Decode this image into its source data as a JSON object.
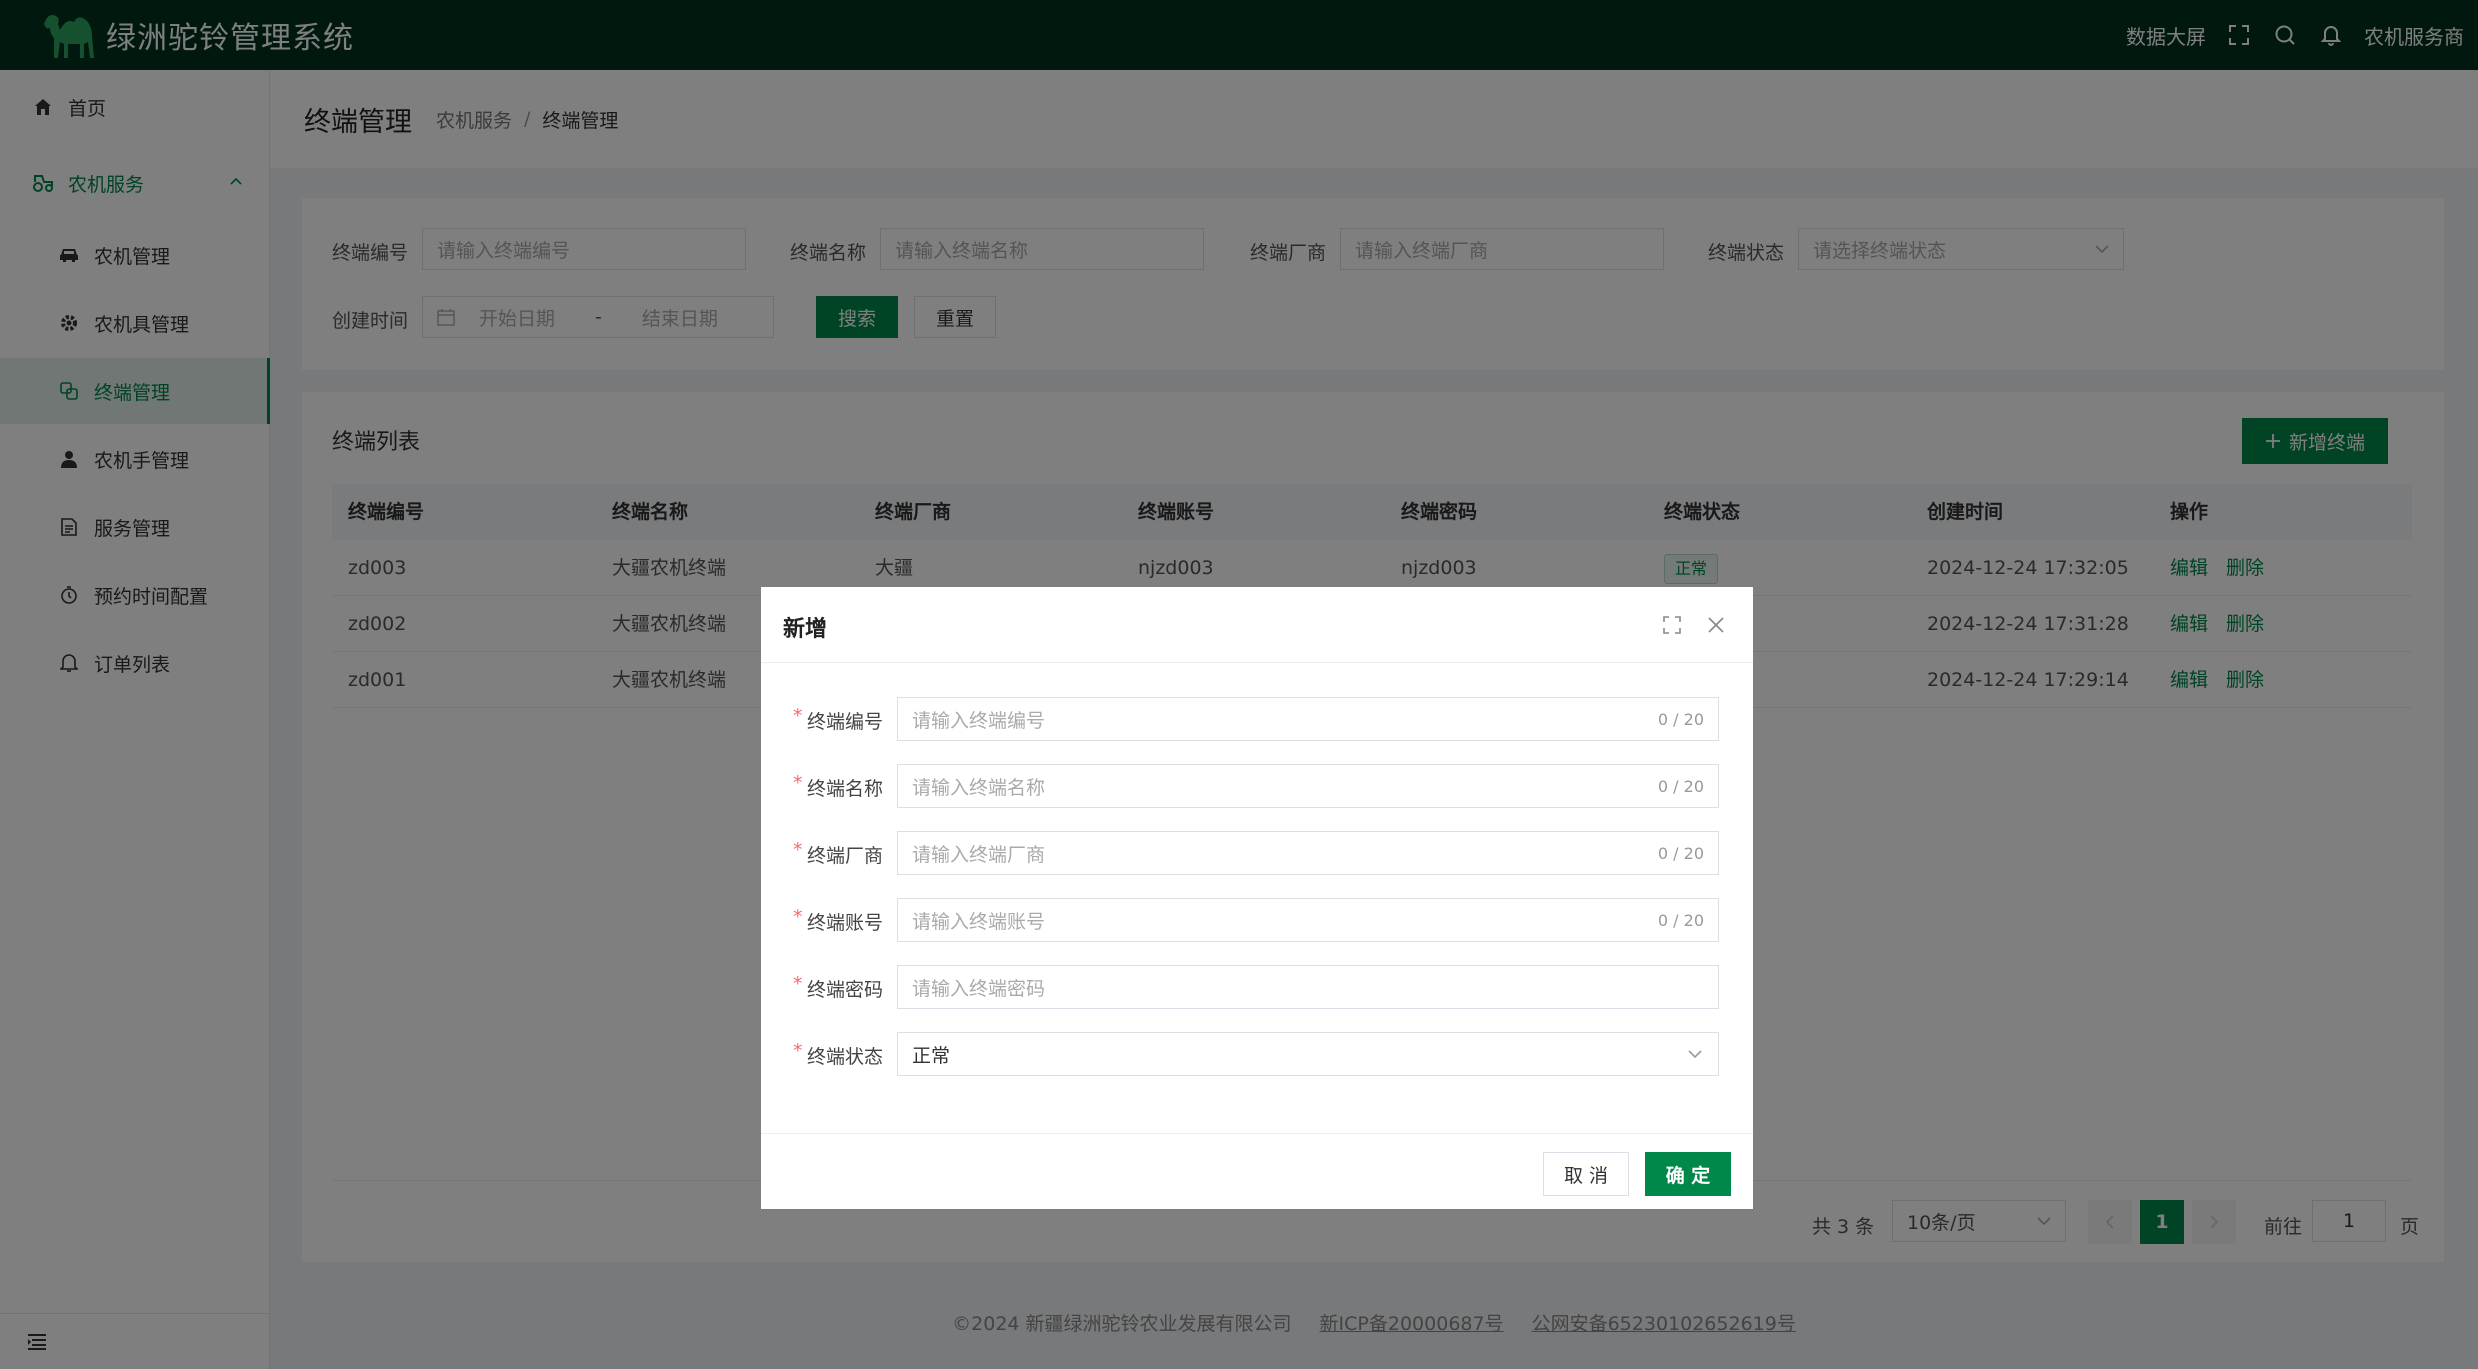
{
  "app": {
    "title": "绿洲驼铃管理系统"
  },
  "topbar": {
    "big_screen": "数据大屏",
    "user": "农机服务商"
  },
  "sidebar": {
    "items": [
      {
        "label": "首页",
        "icon": "home-icon"
      },
      {
        "label": "农机服务",
        "icon": "tractor-icon"
      },
      {
        "label": "农机管理",
        "icon": "car-icon"
      },
      {
        "label": "农机具管理",
        "icon": "gear-icon"
      },
      {
        "label": "终端管理",
        "icon": "terminal-icon"
      },
      {
        "label": "农机手管理",
        "icon": "user-icon"
      },
      {
        "label": "服务管理",
        "icon": "document-icon"
      },
      {
        "label": "预约时间配置",
        "icon": "clock-icon"
      },
      {
        "label": "订单列表",
        "icon": "bell-icon"
      }
    ]
  },
  "page": {
    "title": "终端管理",
    "breadcrumb": [
      "农机服务",
      "/",
      "终端管理"
    ]
  },
  "filters": {
    "code_label": "终端编号",
    "code_placeholder": "请输入终端编号",
    "name_label": "终端名称",
    "name_placeholder": "请输入终端名称",
    "vendor_label": "终端厂商",
    "vendor_placeholder": "请输入终端厂商",
    "status_label": "终端状态",
    "status_placeholder": "请选择终端状态",
    "time_label": "创建时间",
    "start_placeholder": "开始日期",
    "range_sep": "-",
    "end_placeholder": "结束日期",
    "search_button": "搜索",
    "reset_button": "重置"
  },
  "list": {
    "title": "终端列表",
    "add_button": "新增终端",
    "columns": [
      "终端编号",
      "终端名称",
      "终端厂商",
      "终端账号",
      "终端密码",
      "终端状态",
      "创建时间",
      "操作"
    ],
    "rows": [
      {
        "code": "zd003",
        "name": "大疆农机终端",
        "vendor": "大疆",
        "account": "njzd003",
        "password": "njzd003",
        "status": "正常",
        "created": "2024-12-24 17:32:05",
        "edit": "编辑",
        "delete": "删除"
      },
      {
        "code": "zd002",
        "name": "大疆农机终端",
        "vendor": "",
        "account": "",
        "password": "",
        "status": "",
        "created": "2024-12-24 17:31:28",
        "edit": "编辑",
        "delete": "删除"
      },
      {
        "code": "zd001",
        "name": "大疆农机终端",
        "vendor": "",
        "account": "",
        "password": "",
        "status": "",
        "created": "2024-12-24 17:29:14",
        "edit": "编辑",
        "delete": "删除"
      }
    ]
  },
  "pagination": {
    "total": "共 3 条",
    "page_size": "10条/页",
    "current": "1",
    "goto_label": "前往",
    "goto_value": "1",
    "page_suffix": "页"
  },
  "footer": {
    "copyright": "©2024 新疆绿洲驼铃农业发展有限公司",
    "icp": "新ICP备20000687号",
    "police": "公网安备65230102652619号"
  },
  "dialog": {
    "title": "新增",
    "fields": [
      {
        "label": "终端编号",
        "placeholder": "请输入终端编号",
        "counter": "0 / 20"
      },
      {
        "label": "终端名称",
        "placeholder": "请输入终端名称",
        "counter": "0 / 20"
      },
      {
        "label": "终端厂商",
        "placeholder": "请输入终端厂商",
        "counter": "0 / 20"
      },
      {
        "label": "终端账号",
        "placeholder": "请输入终端账号",
        "counter": "0 / 20"
      },
      {
        "label": "终端密码",
        "placeholder": "请输入终端密码",
        "counter": ""
      },
      {
        "label": "终端状态",
        "value": "正常",
        "counter": ""
      }
    ],
    "required_mark": "*",
    "cancel_button": "取 消",
    "confirm_button": "确 定"
  },
  "colors": {
    "brand": "#00874a",
    "topbar": "#00311a"
  }
}
